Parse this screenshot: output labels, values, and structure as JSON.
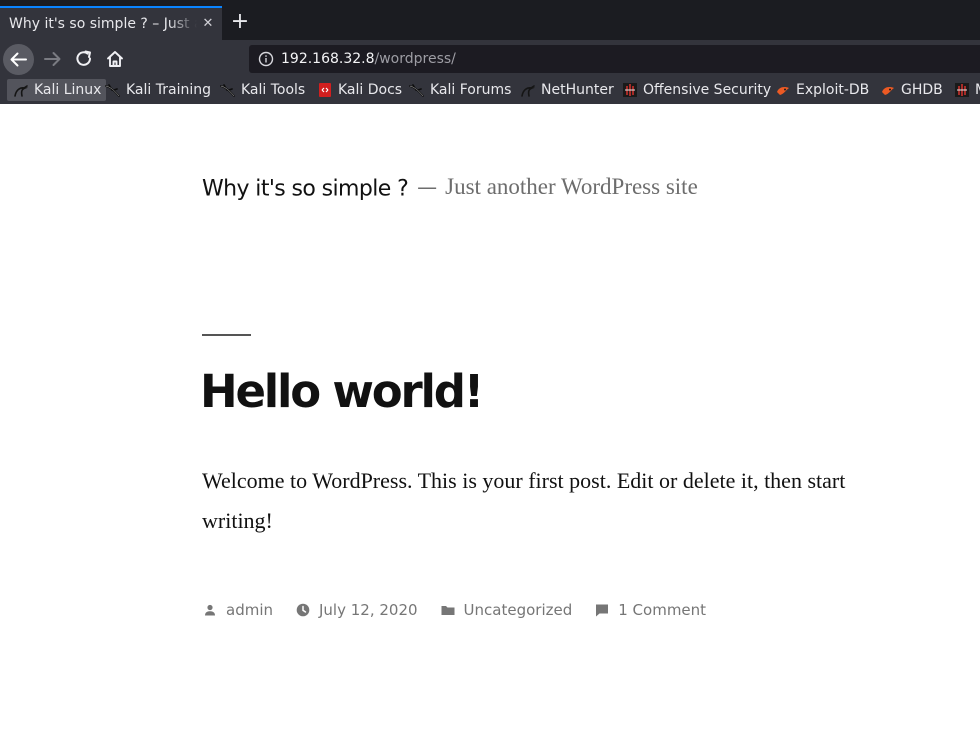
{
  "browser": {
    "tab_title": "Why it's so simple ? – Just another WordPress site",
    "tab_close": "✕",
    "new_tab": "+",
    "url_host": "192.168.32.8",
    "url_path": "/wordpress/",
    "bookmarks": [
      {
        "label": "Kali Linux",
        "icon": "kali-dragon-icon"
      },
      {
        "label": "Kali Training",
        "icon": "kali-dragon-icon"
      },
      {
        "label": "Kali Tools",
        "icon": "kali-dragon-icon"
      },
      {
        "label": "Kali Docs",
        "icon": "kali-docs-icon"
      },
      {
        "label": "Kali Forums",
        "icon": "kali-dragon-icon"
      },
      {
        "label": "NetHunter",
        "icon": "kali-dragon-icon"
      },
      {
        "label": "Offensive Security",
        "icon": "offsec-icon"
      },
      {
        "label": "Exploit-DB",
        "icon": "exploit-db-icon"
      },
      {
        "label": "GHDB",
        "icon": "exploit-db-icon"
      },
      {
        "label": "M",
        "icon": "offsec-icon"
      }
    ]
  },
  "site": {
    "title": "Why it's so simple ?",
    "separator": "—",
    "description": "Just another WordPress site"
  },
  "post": {
    "title": "Hello world!",
    "content": "Welcome to WordPress. This is your first post. Edit or delete it, then start writing!",
    "author": "admin",
    "date": "July 12, 2020",
    "category": "Uncategorized",
    "comments": "1 Comment"
  },
  "colors": {
    "tab_accent": "#0a84ff",
    "chrome_bg": "#33343c",
    "meta_text": "#767676"
  }
}
